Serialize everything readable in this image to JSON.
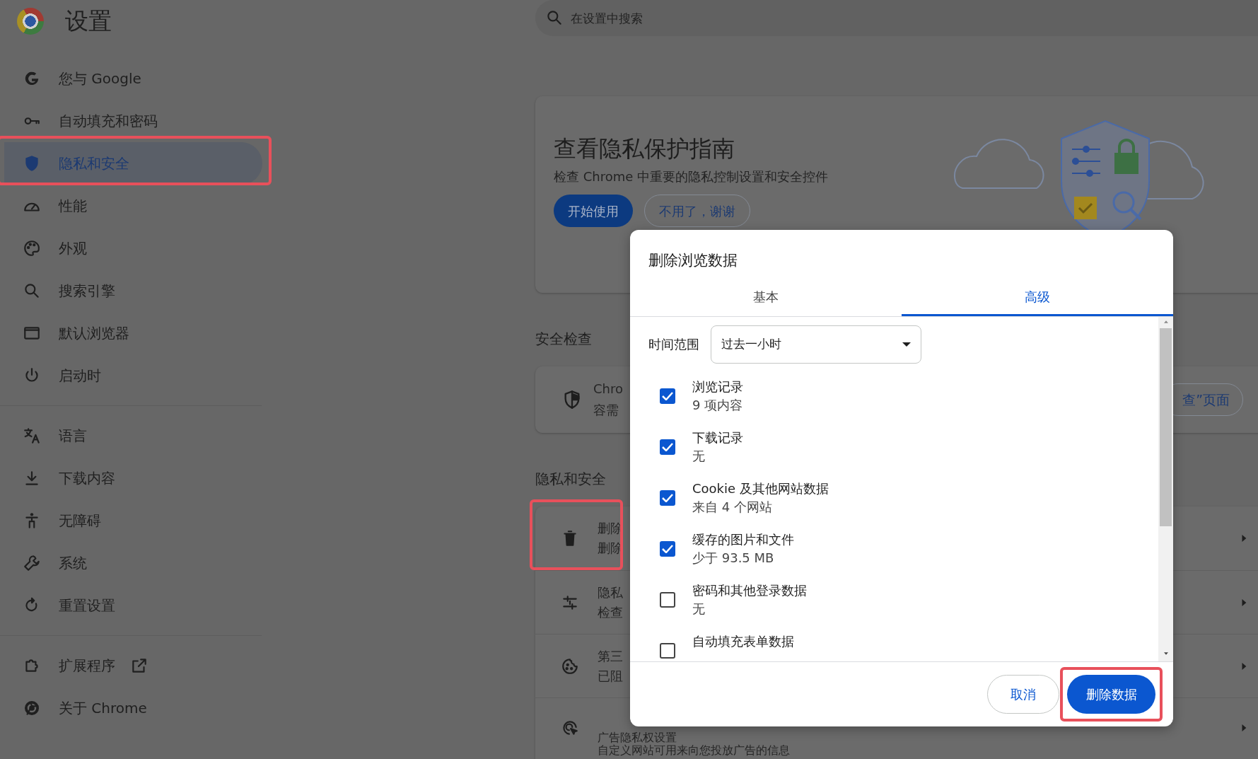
{
  "header": {
    "title": "设置",
    "search": {
      "placeholder": "在设置中搜索"
    }
  },
  "sidebar": {
    "groups": [
      {
        "items": [
          {
            "label": "您与 Google",
            "selected": false,
            "annotated": false,
            "external_link": false
          },
          {
            "label": "自动填充和密码",
            "selected": false,
            "annotated": false,
            "external_link": false
          },
          {
            "label": "隐私和安全",
            "selected": true,
            "annotated": true,
            "external_link": false
          },
          {
            "label": "性能",
            "selected": false,
            "annotated": false,
            "external_link": false
          },
          {
            "label": "外观",
            "selected": false,
            "annotated": false,
            "external_link": false
          },
          {
            "label": "搜索引擎",
            "selected": false,
            "annotated": false,
            "external_link": false
          },
          {
            "label": "默认浏览器",
            "selected": false,
            "annotated": false,
            "external_link": false
          },
          {
            "label": "启动时",
            "selected": false,
            "annotated": false,
            "external_link": false
          }
        ]
      },
      {
        "items": [
          {
            "label": "语言",
            "selected": false,
            "annotated": false,
            "external_link": false
          },
          {
            "label": "下载内容",
            "selected": false,
            "annotated": false,
            "external_link": false
          },
          {
            "label": "无障碍",
            "selected": false,
            "annotated": false,
            "external_link": false
          },
          {
            "label": "系统",
            "selected": false,
            "annotated": false,
            "external_link": false
          },
          {
            "label": "重置设置",
            "selected": false,
            "annotated": false,
            "external_link": false
          }
        ]
      },
      {
        "items": [
          {
            "label": "扩展程序",
            "selected": false,
            "annotated": false,
            "external_link": true
          },
          {
            "label": "关于 Chrome",
            "selected": false,
            "annotated": false,
            "external_link": false
          }
        ]
      }
    ]
  },
  "privacy_guide": {
    "title": "查看隐私保护指南",
    "description": "检查 Chrome 中重要的隐私控制设置和安全控件",
    "buttons": [
      {
        "label": "开始使用",
        "kind": "primary"
      },
      {
        "label": "不用了，谢谢",
        "kind": "outline"
      }
    ]
  },
  "safety_check": {
    "heading": "安全检查",
    "lines": [
      "Chro",
      "容需"
    ],
    "button": "查”页面"
  },
  "privacy_section": {
    "heading": "隐私和安全",
    "rows": [
      {
        "title": "删除",
        "subtitle": "删除",
        "annotated": true
      },
      {
        "title": "隐私",
        "subtitle": "检查",
        "annotated": false
      },
      {
        "title": "第三",
        "subtitle": "已阻",
        "annotated": false
      },
      {
        "title": "广告隐私权设置",
        "subtitle": "自定义网站可用来向您投放广告的信息",
        "annotated": false
      }
    ]
  },
  "dialog": {
    "title": "删除浏览数据",
    "tabs": [
      {
        "label": "基本",
        "selected": false
      },
      {
        "label": "高级",
        "selected": true
      }
    ],
    "time_range": {
      "label": "时间范围",
      "value": "过去一小时"
    },
    "items": [
      {
        "label": "浏览记录",
        "detail": "9 项内容",
        "checked": true
      },
      {
        "label": "下载记录",
        "detail": "无",
        "checked": true
      },
      {
        "label": "Cookie 及其他网站数据",
        "detail": "来自 4 个网站",
        "checked": true
      },
      {
        "label": "缓存的图片和文件",
        "detail": "少于 93.5 MB",
        "checked": true
      },
      {
        "label": "密码和其他登录数据",
        "detail": "无",
        "checked": false
      },
      {
        "label": "自动填充表单数据",
        "checked": false
      }
    ],
    "buttons": [
      {
        "label": "取消",
        "kind": "secondary",
        "annotated": false
      },
      {
        "label": "删除数据",
        "kind": "primary",
        "annotated": true
      }
    ]
  }
}
